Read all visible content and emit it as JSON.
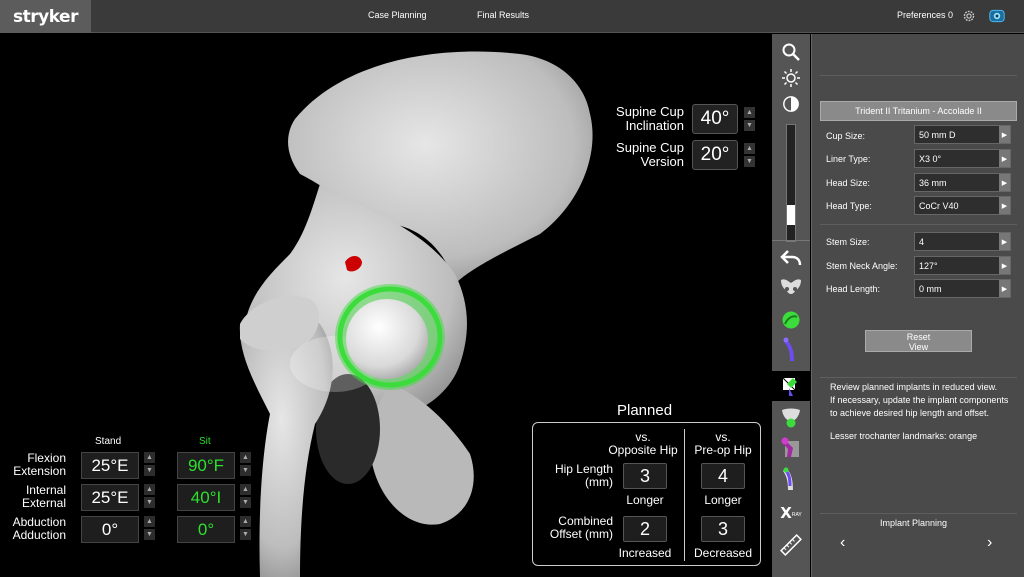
{
  "header": {
    "logo": "stryker",
    "tabs": [
      "Case Planning",
      "Final Results"
    ],
    "preferences_label": "Preferences 0",
    "settings_icon": "gear-icon",
    "view_icon": "eye-icon"
  },
  "cup": {
    "inclination": {
      "label_line1": "Supine Cup",
      "label_line2": "Inclination",
      "value": "40°"
    },
    "version": {
      "label_line1": "Supine Cup",
      "label_line2": "Version",
      "value": "20°"
    }
  },
  "motion": {
    "stand_label": "Stand",
    "sit_label": "Sit",
    "rows": [
      {
        "label_line1": "Flexion",
        "label_line2": "Extension",
        "stand": "25°E",
        "sit": "90°F"
      },
      {
        "label_line1": "Internal",
        "label_line2": "External",
        "stand": "25°E",
        "sit": "40°I"
      },
      {
        "label_line1": "Abduction",
        "label_line2": "Adduction",
        "stand": "0°",
        "sit": "0°"
      }
    ]
  },
  "planned": {
    "title": "Planned",
    "col1_line1": "vs.",
    "col1_line2": "Opposite Hip",
    "col2_line1": "vs.",
    "col2_line2": "Pre-op Hip",
    "hip_length_line1": "Hip Length",
    "hip_length_line2": "(mm)",
    "hip_length_opposite": "3",
    "hip_length_opposite_note": "Longer",
    "hip_length_preop": "4",
    "hip_length_preop_note": "Longer",
    "offset_line1": "Combined",
    "offset_line2": "Offset (mm)",
    "offset_opposite": "2",
    "offset_opposite_note": "Increased",
    "offset_preop": "3",
    "offset_preop_note": "Decreased"
  },
  "toolbar": {
    "icons": [
      "magnifier-icon",
      "brightness-icon",
      "contrast-icon",
      "undo-icon",
      "pelvis-icon",
      "cup-icon",
      "stem-icon",
      "reduced-view-icon",
      "femur-cup-icon",
      "neck-icon",
      "femur-stem-icon",
      "xray-icon",
      "ruler-icon"
    ],
    "contrast_slider_fraction": 0.3,
    "xray_label": "X"
  },
  "panel": {
    "implant_title": "Trident II Tritanium - Accolade II",
    "fields": [
      {
        "label": "Cup Size:",
        "value": "50 mm D"
      },
      {
        "label": "Liner Type:",
        "value": "X3 0°"
      },
      {
        "label": "Head Size:",
        "value": "36 mm"
      },
      {
        "label": "Head Type:",
        "value": "CoCr V40"
      },
      {
        "label": "Stem Size:",
        "value": "4"
      },
      {
        "label": "Stem Neck Angle:",
        "value": "127°"
      },
      {
        "label": "Head Length:",
        "value": "0 mm"
      }
    ],
    "reset_line1": "Reset",
    "reset_line2": "View",
    "info_lines": [
      "Review planned implants in reduced view.",
      "If necessary, update the implant components to achieve desired hip length and offset.",
      "",
      "Lesser trochanter landmarks: orange"
    ],
    "footer_label": "Implant Planning",
    "prev_arrow": "‹",
    "next_arrow": "›"
  },
  "colors": {
    "accent_green": "#2de02d",
    "landmark_red": "#cc0000",
    "cup_green": "#3ddc3d",
    "toolbar_bg": "#555555",
    "panel_bg": "#4a4a4a"
  }
}
